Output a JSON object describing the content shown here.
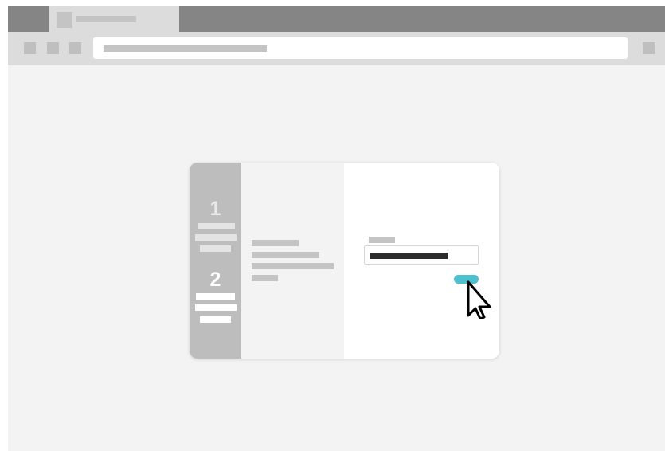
{
  "browser": {
    "tab": {
      "favicon": "page-favicon-placeholder",
      "title_placeholder": "redacted-tab-title"
    },
    "toolbar": {
      "nav_buttons": [
        "back-button",
        "forward-button",
        "reload-button"
      ],
      "address_placeholder": "redacted-url",
      "menu_button": "menu-button"
    }
  },
  "dialog": {
    "stepper": {
      "steps": [
        {
          "number": "1",
          "state": "completed"
        },
        {
          "number": "2",
          "state": "active"
        }
      ]
    },
    "info_panel": {
      "lines": 4
    },
    "form": {
      "label": "redacted-field-label",
      "value": "redacted-entered-text",
      "button": "redacted-next-button"
    }
  },
  "cursor": "pointer-arrow-icon",
  "colors": {
    "accent": "#4ebfcf",
    "stepper_bg": "#bdbdbd",
    "chrome_dark": "#858585",
    "chrome_light": "#dcdcdc",
    "page_bg": "#f3f3f3"
  }
}
